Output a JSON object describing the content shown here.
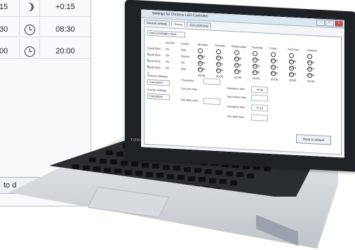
{
  "background_window": {
    "rows": [
      {
        "col1": "15",
        "col3": "+0:15",
        "icon": "moon-icon"
      },
      {
        "col1": "30",
        "col3": "08:30",
        "icon": "clock-icon"
      },
      {
        "col1": "00",
        "col3": "20:00",
        "icon": "clock-icon"
      }
    ],
    "button_label": "to d"
  },
  "laptop": {
    "brand": "TOSHIBA",
    "app": {
      "title": "Settings for Chronos LED Controller",
      "window_buttons": [
        "–",
        "□",
        "×"
      ],
      "tabs": [
        "General settings",
        "Timers",
        "Zero profit time"
      ],
      "profile_select": "DayCycle/Night mode",
      "grid_headers": [
        "On/Off",
        "Action",
        "Monday",
        "Tuesday",
        "Wednesday",
        "Thursday",
        "Friday",
        "Saturday",
        "Sunday"
      ],
      "rows": [
        {
          "name": "CycleTime 1",
          "onoff": "On",
          "action": "Dim",
          "time": "07:00"
        },
        {
          "name": "CycleTime 2",
          "onoff": "On",
          "action": "Gloom",
          "time": "+0:15"
        },
        {
          "name": "CycleTime 3",
          "onoff": "On",
          "action": "On",
          "time": "07:30"
        },
        {
          "name": "CycleTime 4",
          "onoff": "On",
          "action": "Dim",
          "time": "20:00"
        }
      ],
      "sunrise_label": "Sunrise settings:",
      "sunset_label": "Sunset settings:",
      "sunrise_select": "Calculated",
      "sunset_select": "Calculated",
      "threshold_label": "Threshold",
      "sun_rise_label": "Sun rise time",
      "not_after_label": "Not after time",
      "deviation_label": "Deviation time",
      "not_before_label": "Not before time",
      "deviation_value_1": "+0:30",
      "deviation_value_2": "+0:15",
      "back_button": "Back to default"
    }
  }
}
